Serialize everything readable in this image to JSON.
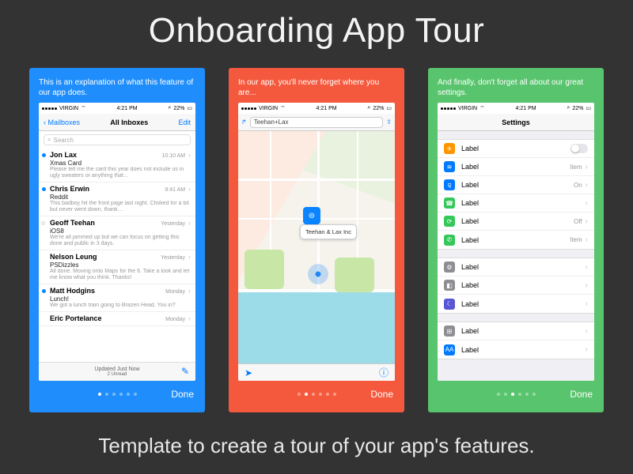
{
  "title": "Onboarding App Tour",
  "subtitle": "Template to create a tour of your app's features.",
  "statusbar": {
    "carrier": "VIRGIN",
    "time": "4:21 PM",
    "battery": "22%"
  },
  "done_label": "Done",
  "cards": [
    {
      "tagline": "This is an explanation of what this feature of our app does.",
      "nav": {
        "back": "Mailboxes",
        "title": "All Inboxes",
        "right": "Edit"
      },
      "search_placeholder": "Search",
      "footer": {
        "top": "Updated Just Now",
        "bottom": "2 Unread"
      },
      "page_active": 0,
      "mail": [
        {
          "unread": true,
          "sender": "Jon Lax",
          "time": "10:10 AM",
          "subject": "Xmas Card",
          "preview": "Please tell me the card this year does not include us in ugly sweaters or anything that…"
        },
        {
          "unread": true,
          "sender": "Chris Erwin",
          "time": "9:41 AM",
          "subject": "Reddit",
          "preview": "This badboy hit the front page last night. Choked for a bit but never went down, thank…"
        },
        {
          "star": true,
          "sender": "Geoff Teehan",
          "time": "Yesterday",
          "subject": "iOS8",
          "preview": "We're all jammed up but we can focus on getting this done and public in 3 days."
        },
        {
          "sender": "Nelson Leung",
          "time": "Yesterday",
          "subject": "PSDizzles",
          "preview": "All done. Moving onto Maps for the 6. Take a look and let me know what you think. Thanks!"
        },
        {
          "unread": true,
          "sender": "Matt Hodgins",
          "time": "Monday",
          "subject": "Lunch!",
          "preview": "We got a lunch train going to Brazen Head. You in?"
        },
        {
          "sender": "Eric Portelance",
          "time": "Monday",
          "subject": "",
          "preview": ""
        }
      ]
    },
    {
      "tagline": "In our app, you'll never forget where you are...",
      "nav": {
        "search_value": "Teehan+Lax"
      },
      "pin_label": "Teehan & Lax Inc",
      "page_active": 1
    },
    {
      "tagline": "And finally, don't forget all about our great settings.",
      "nav": {
        "title": "Settings"
      },
      "page_active": 2,
      "groups": [
        [
          {
            "color": "#ff9500",
            "glyph": "✈",
            "label": "Label",
            "toggle": true
          },
          {
            "color": "#007aff",
            "glyph": "≋",
            "label": "Label",
            "value": "Item"
          },
          {
            "color": "#007aff",
            "glyph": "⚼",
            "label": "Label",
            "value": "On"
          },
          {
            "color": "#34c759",
            "glyph": "☎",
            "label": "Label",
            "value": ""
          },
          {
            "color": "#34c759",
            "glyph": "⟳",
            "label": "Label",
            "value": "Off"
          },
          {
            "color": "#34c759",
            "glyph": "✆",
            "label": "Label",
            "value": "Item"
          }
        ],
        [
          {
            "color": "#8e8e93",
            "glyph": "⚙",
            "label": "Label",
            "value": ""
          },
          {
            "color": "#8e8e93",
            "glyph": "◧",
            "label": "Label",
            "value": ""
          },
          {
            "color": "#5856d6",
            "glyph": "☾",
            "label": "Label",
            "value": ""
          }
        ],
        [
          {
            "color": "#8e8e93",
            "glyph": "⊞",
            "label": "Label",
            "value": ""
          },
          {
            "color": "#007aff",
            "glyph": "AA",
            "label": "Label",
            "value": ""
          }
        ]
      ]
    }
  ]
}
